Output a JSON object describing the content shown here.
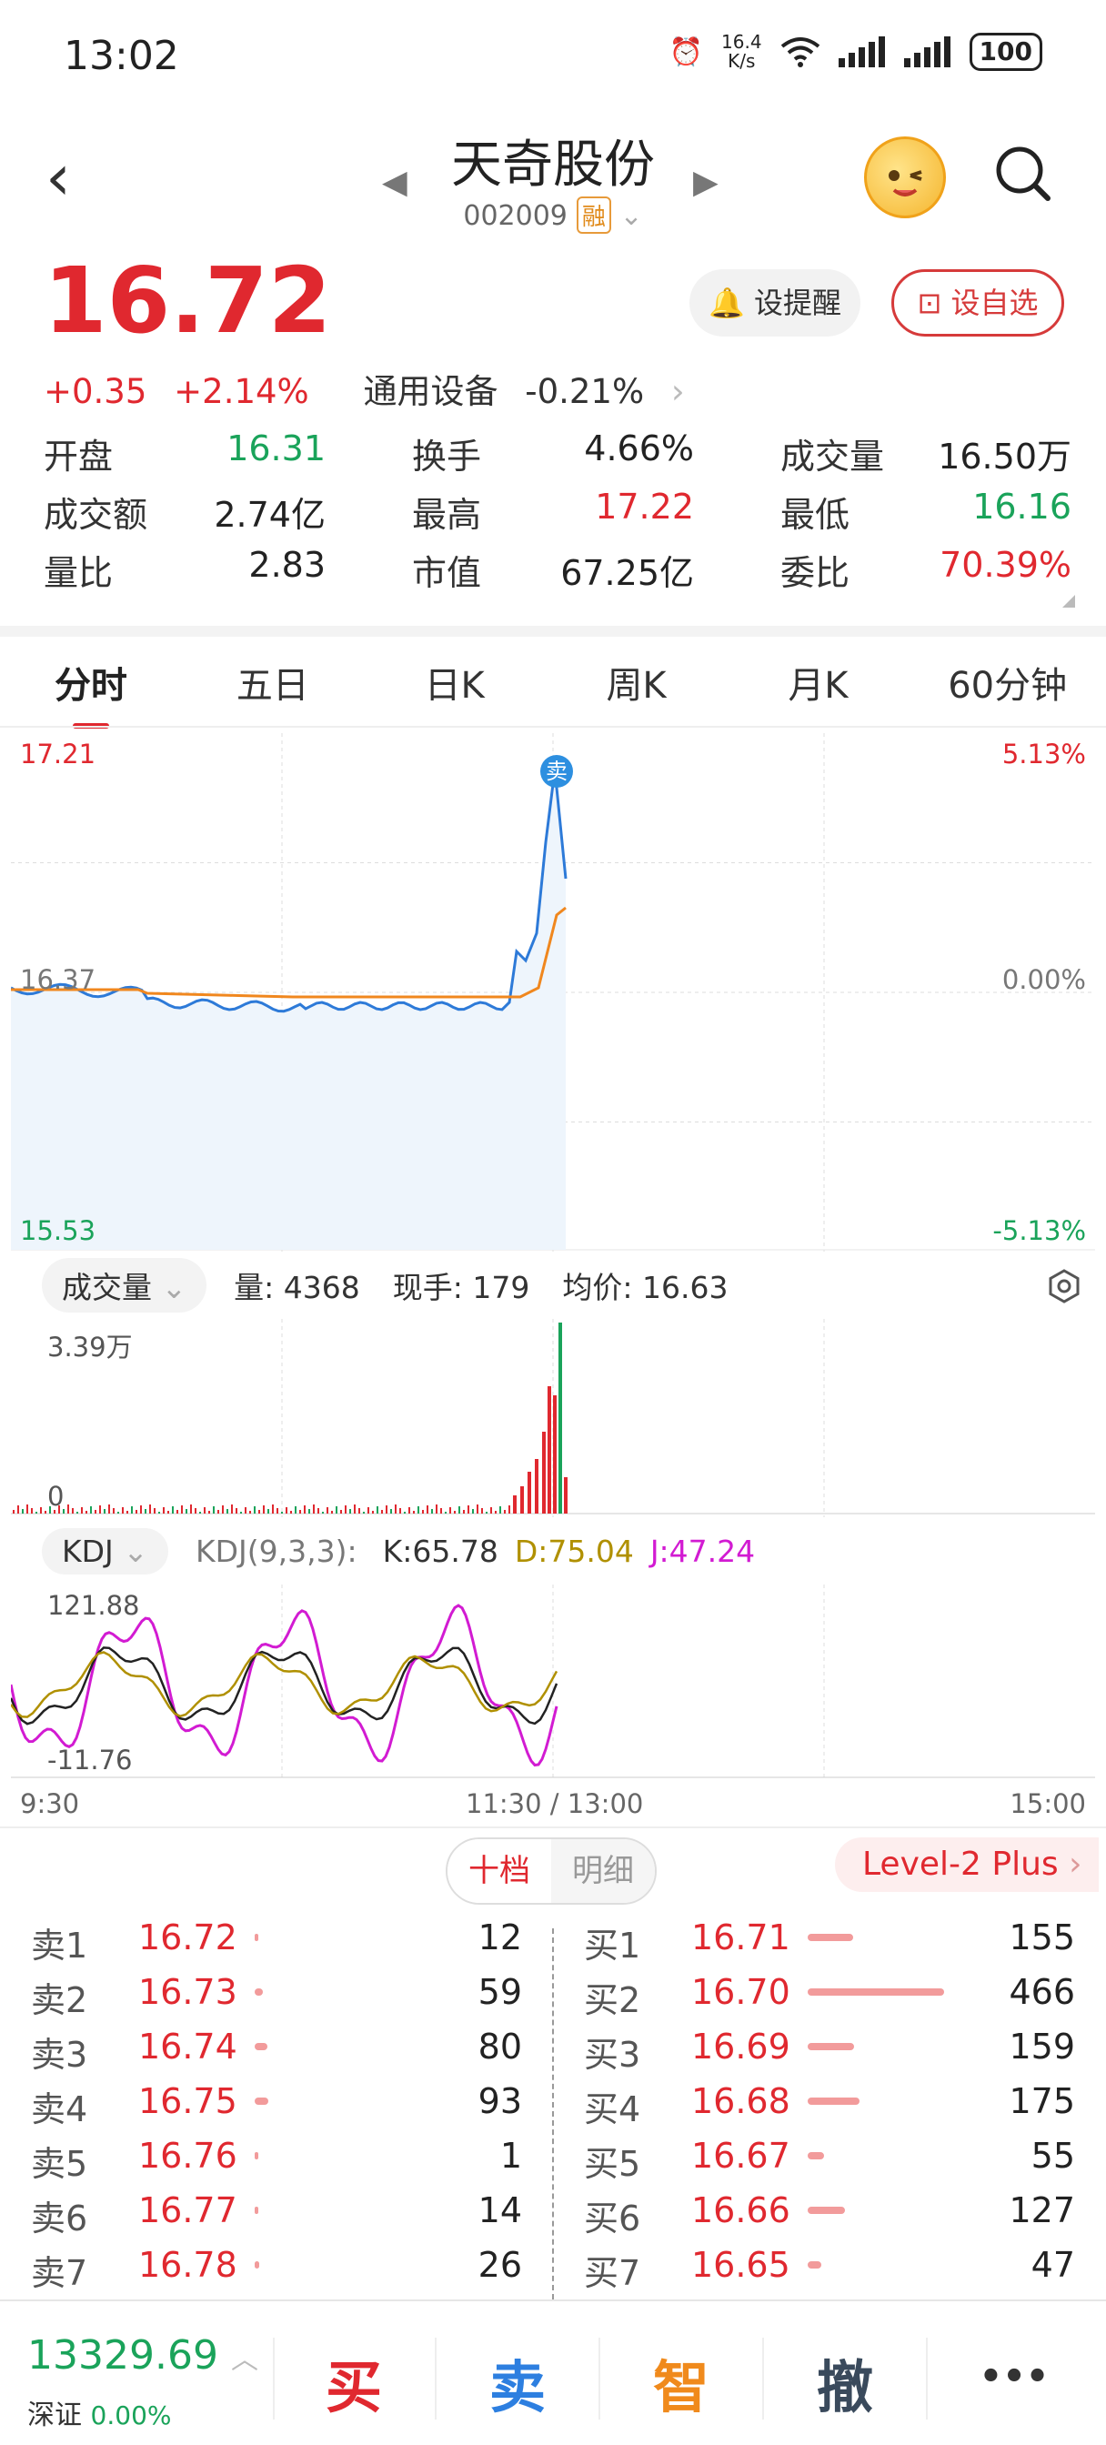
{
  "status_bar": {
    "time": "13:02",
    "speed_top": "16.4",
    "speed_unit": "K/s",
    "battery": "100"
  },
  "header": {
    "title": "天奇股份",
    "code": "002009",
    "margin_badge": "融"
  },
  "price": {
    "current": "16.72",
    "change": "+0.35",
    "change_pct": "+2.14%",
    "sector": "通用设备",
    "sector_change": "-0.21%",
    "remind_label": "设提醒",
    "fav_label": "设自选"
  },
  "quote": [
    [
      {
        "label": "开盘",
        "value": "16.31",
        "color": "green"
      },
      {
        "label": "换手",
        "value": "4.66%",
        "color": "black"
      },
      {
        "label": "成交量",
        "value": "16.50万",
        "color": "black"
      }
    ],
    [
      {
        "label": "成交额",
        "value": "2.74亿",
        "color": "black"
      },
      {
        "label": "最高",
        "value": "17.22",
        "color": "red"
      },
      {
        "label": "最低",
        "value": "16.16",
        "color": "green"
      }
    ],
    [
      {
        "label": "量比",
        "value": "2.83",
        "color": "black"
      },
      {
        "label": "市值",
        "value": "67.25亿",
        "color": "black"
      },
      {
        "label": "委比",
        "value": "70.39%",
        "color": "red"
      }
    ]
  ],
  "tabs": [
    "分时",
    "五日",
    "日K",
    "周K",
    "月K",
    "60分钟"
  ],
  "intraday": {
    "price_high": "17.21",
    "price_mid": "16.37",
    "price_low": "15.53",
    "pct_high": "5.13%",
    "pct_mid": "0.00%",
    "pct_low": "-5.13%",
    "sell_marker": "卖"
  },
  "volume": {
    "chip": "成交量",
    "qty": "量: 4368",
    "hand": "现手: 179",
    "avg": "均价: 16.63",
    "max_label": "3.39万",
    "zero_label": "0"
  },
  "kdj": {
    "chip": "KDJ",
    "params": "KDJ(9,3,3):",
    "k": "K:65.78",
    "d": "D:75.04",
    "j": "J:47.24",
    "max_label": "121.88",
    "min_label": "-11.76"
  },
  "time_axis": {
    "start": "9:30",
    "mid": "11:30 / 13:00",
    "end": "15:00"
  },
  "order_book": {
    "seg_active": "十档",
    "seg_other": "明细",
    "level2": "Level-2 Plus",
    "sells": [
      {
        "label": "卖1",
        "price": "16.72",
        "qty": "12",
        "share": 0.02
      },
      {
        "label": "卖2",
        "price": "16.73",
        "qty": "59",
        "share": 0.06
      },
      {
        "label": "卖3",
        "price": "16.74",
        "qty": "80",
        "share": 0.09
      },
      {
        "label": "卖4",
        "price": "16.75",
        "qty": "93",
        "share": 0.1
      },
      {
        "label": "卖5",
        "price": "16.76",
        "qty": "1",
        "share": 0.01
      },
      {
        "label": "卖6",
        "price": "16.77",
        "qty": "14",
        "share": 0.02
      },
      {
        "label": "卖7",
        "price": "16.78",
        "qty": "26",
        "share": 0.03
      }
    ],
    "buys": [
      {
        "label": "买1",
        "price": "16.71",
        "qty": "155",
        "share": 0.33
      },
      {
        "label": "买2",
        "price": "16.70",
        "qty": "466",
        "share": 1.0
      },
      {
        "label": "买3",
        "price": "16.69",
        "qty": "159",
        "share": 0.34
      },
      {
        "label": "买4",
        "price": "16.68",
        "qty": "175",
        "share": 0.38
      },
      {
        "label": "买5",
        "price": "16.67",
        "qty": "55",
        "share": 0.12
      },
      {
        "label": "买6",
        "price": "16.66",
        "qty": "127",
        "share": 0.27
      },
      {
        "label": "买7",
        "price": "16.65",
        "qty": "47",
        "share": 0.1
      }
    ]
  },
  "bottom_bar": {
    "index_value": "13329.69",
    "index_name": "深证",
    "index_change": "0.00%",
    "buy": "买",
    "sell": "卖",
    "smart": "智",
    "cancel": "撤",
    "more": "•••"
  }
}
